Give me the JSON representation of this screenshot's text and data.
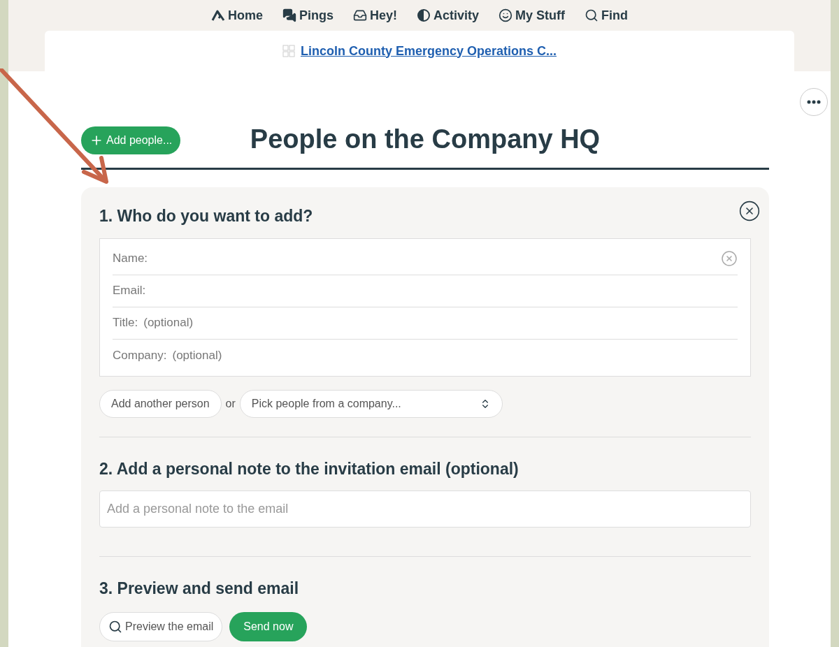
{
  "nav": [
    {
      "label": "Home"
    },
    {
      "label": "Pings"
    },
    {
      "label": "Hey!"
    },
    {
      "label": "Activity"
    },
    {
      "label": "My Stuff"
    },
    {
      "label": "Find"
    }
  ],
  "breadcrumb": "Lincoln County Emergency Operations C...",
  "add_button": "Add people...",
  "title": "People on the Company HQ",
  "step1": {
    "heading": "1. Who do you want to add?",
    "fields": [
      {
        "label": "Name:"
      },
      {
        "label": "Email:"
      },
      {
        "label": "Title:",
        "placeholder": "(optional)"
      },
      {
        "label": "Company:",
        "placeholder": "(optional)"
      }
    ],
    "add_another": "Add another person",
    "or": "or",
    "picker": "Pick people from a company..."
  },
  "step2": {
    "heading": "2. Add a personal note to the invitation email (optional)",
    "placeholder": "Add a personal note to the email"
  },
  "step3": {
    "heading": "3. Preview and send email",
    "preview": "Preview the email",
    "send": "Send now"
  }
}
